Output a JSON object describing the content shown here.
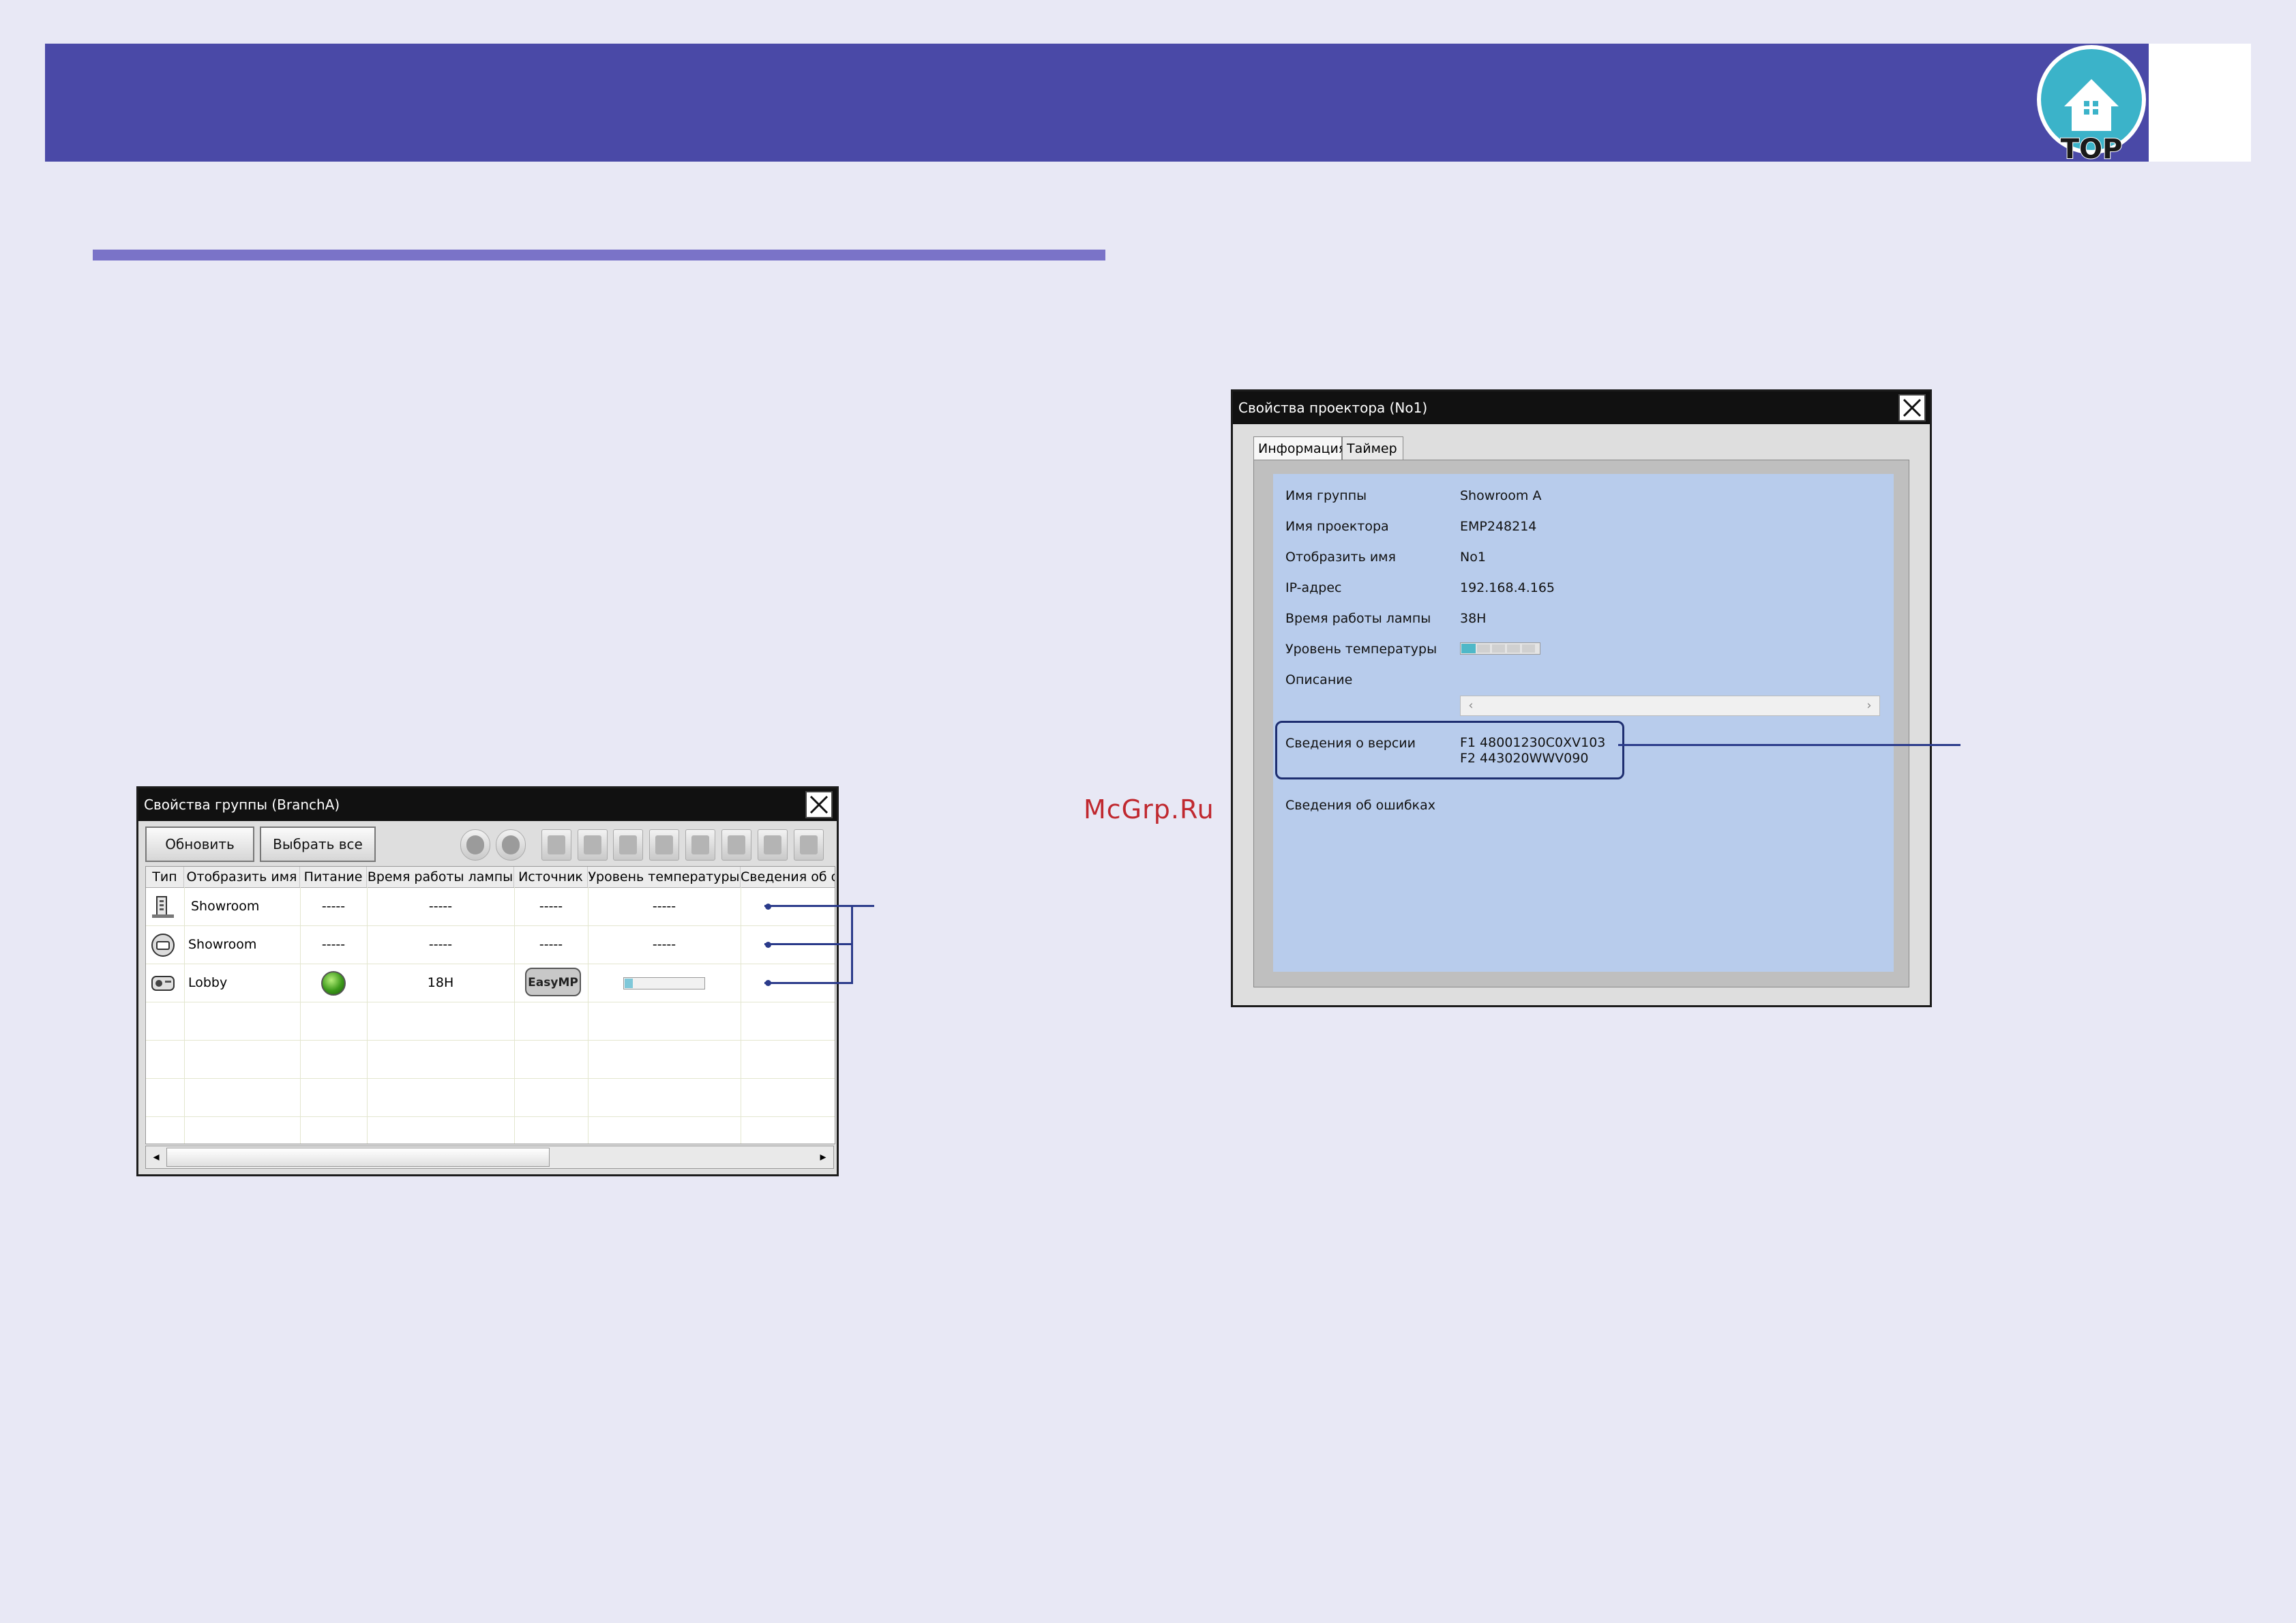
{
  "page": {
    "top_logo": {
      "label": "TOP",
      "icon": "home-icon",
      "color": "#3bb3c9"
    },
    "watermark": "McGrp.Ru",
    "banner_color": "#4a49a7",
    "rule_color": "#7a73c8"
  },
  "group_window": {
    "title": "Свойства группы (BranchA)",
    "toolbar": {
      "refresh_label": "Обновить",
      "select_all_label": "Выбрать все",
      "icons": [
        "power-on-icon",
        "power-off-icon",
        "source-computer-icon",
        "source-video-icon",
        "source-easymp-icon",
        "av-mute-icon",
        "freeze-icon",
        "source-search-icon",
        "volume-icon",
        "mp-icon"
      ]
    },
    "columns": [
      "Тип",
      "Отобразить имя",
      "Питание",
      "Время работы лампы",
      "Источник",
      "Уровень температуры",
      "Сведения об о"
    ],
    "rows": [
      {
        "type_icon": "building-group-icon",
        "name": "Showroom",
        "power": "-----",
        "lamp": "-----",
        "source": "-----",
        "temp": "-----"
      },
      {
        "type_icon": "group-icon",
        "name": "Showroom",
        "power": "-----",
        "lamp": "-----",
        "source": "-----",
        "temp": "-----"
      },
      {
        "type_icon": "projector-icon",
        "name": "Lobby",
        "power_icon": "power-on-led-icon",
        "lamp": "18H",
        "source_icon": "easymp-icon",
        "source_badge": "EasyMP",
        "temp_level": 0.1
      }
    ]
  },
  "projector_window": {
    "title": "Свойства проектора (No1)",
    "tabs": [
      "Информация",
      "Таймер"
    ],
    "fields": [
      {
        "label": "Имя группы",
        "value": "Showroom A"
      },
      {
        "label": "Имя проектора",
        "value": "EMP248214"
      },
      {
        "label": "Отобразить имя",
        "value": "No1"
      },
      {
        "label": "IP-адрес",
        "value": "192.168.4.165"
      },
      {
        "label": "Время работы лампы",
        "value": "38H"
      }
    ],
    "temp_label": "Уровень температуры",
    "temp_level": 0.18,
    "description_label": "Описание",
    "version_label": "Сведения о версии",
    "version_lines": [
      "F1 48001230C0XV103",
      "F2 443020WWV090"
    ],
    "errors_label": "Сведения об ошибках"
  }
}
